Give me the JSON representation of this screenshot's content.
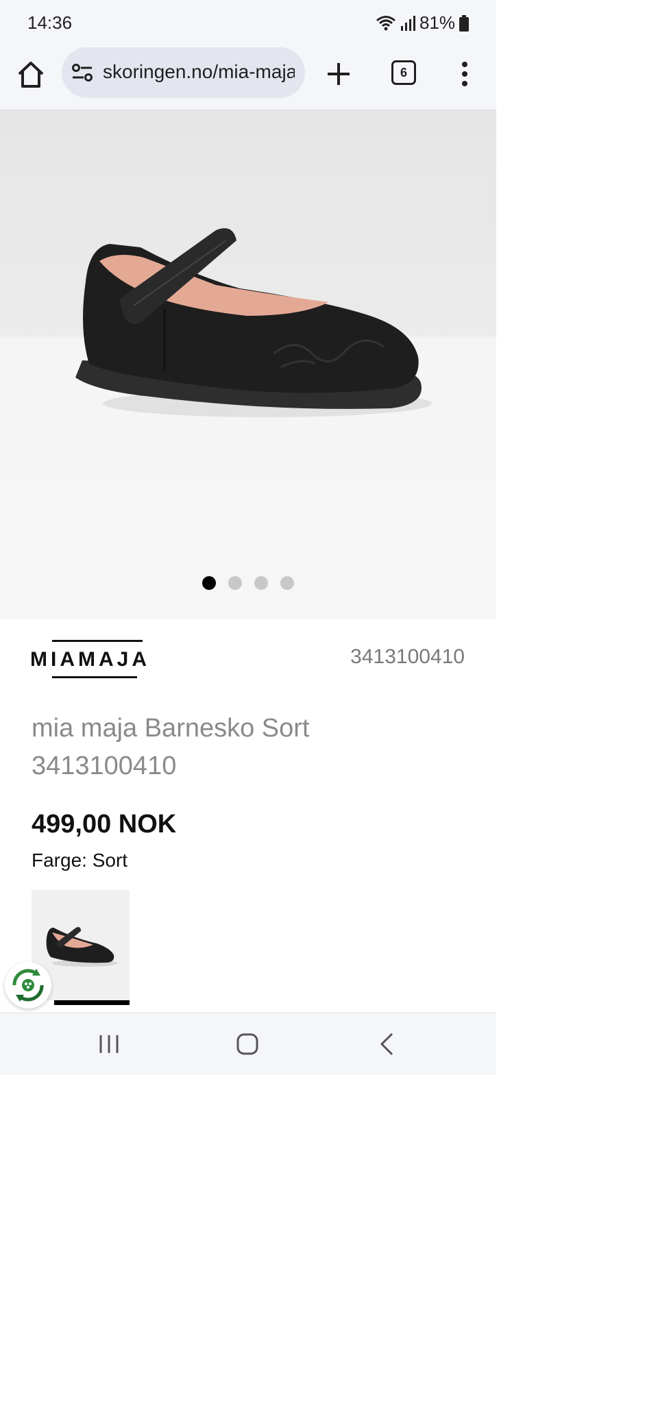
{
  "status_bar": {
    "time": "14:36",
    "battery": "81%"
  },
  "browser": {
    "url": "skoringen.no/mia-maja",
    "tab_count": "6"
  },
  "gallery": {
    "image_count": 4,
    "active_index": 0
  },
  "product": {
    "brand": "MIAMAJA",
    "sku": "3413100410",
    "title": "mia maja Barnesko Sort 3413100410",
    "price": "499,00 NOK",
    "color_line": "Farge: Sort"
  }
}
